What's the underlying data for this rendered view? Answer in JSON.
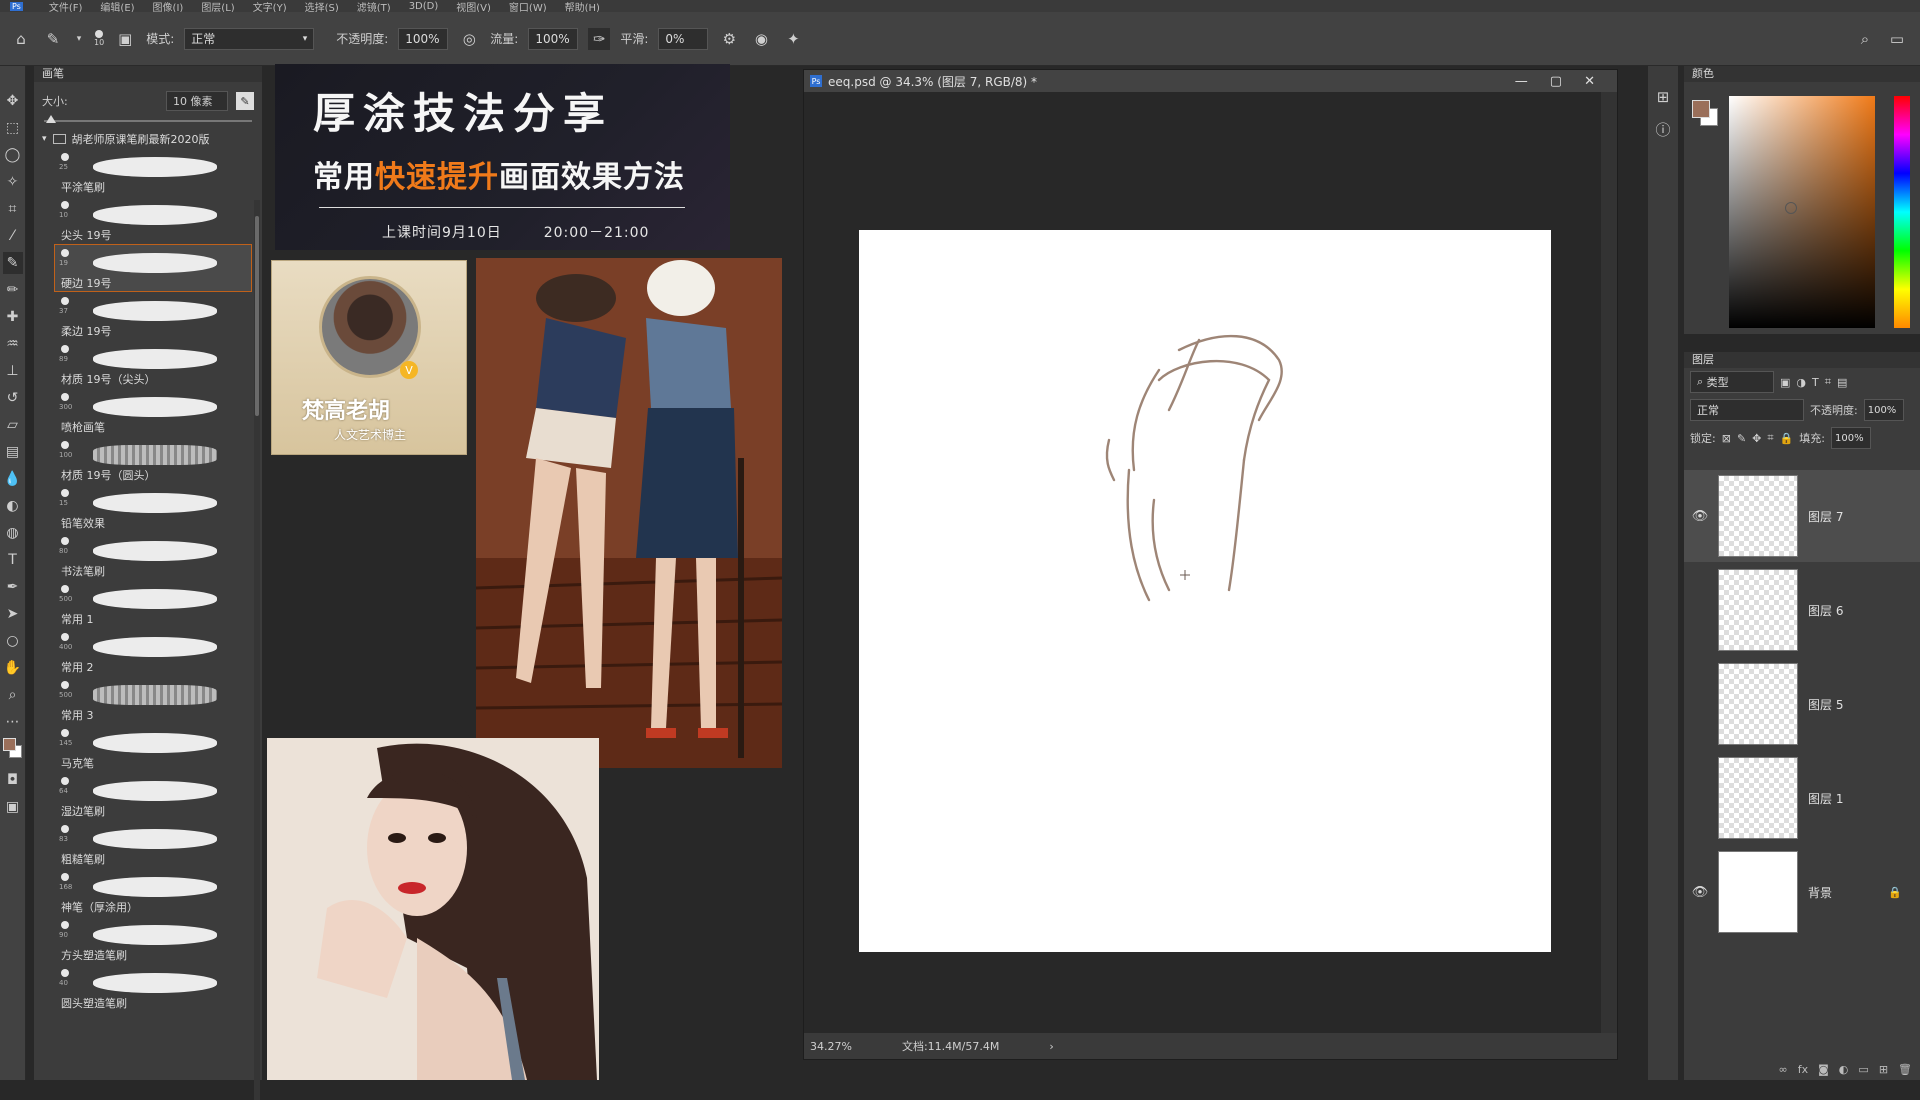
{
  "menu": {
    "items": [
      "文件(F)",
      "编辑(E)",
      "图像(I)",
      "图层(L)",
      "文字(Y)",
      "选择(S)",
      "滤镜(T)",
      "3D(D)",
      "视图(V)",
      "窗口(W)",
      "帮助(H)"
    ]
  },
  "options": {
    "brush_size_small": "10",
    "mode_label": "模式:",
    "mode_value": "正常",
    "opacity_label": "不透明度:",
    "opacity_value": "100%",
    "flow_label": "流量:",
    "flow_value": "100%",
    "smooth_label": "平滑:",
    "smooth_value": "0%"
  },
  "brush_panel": {
    "title": "画笔",
    "size_label": "大小:",
    "size_value": "10 像素",
    "folder": "胡老师原课笔刷最新2020版",
    "brushes": [
      {
        "num": "25",
        "label": "平涂笔刷"
      },
      {
        "num": "10",
        "label": "尖头 19号"
      },
      {
        "num": "19",
        "label": "硬边 19号"
      },
      {
        "num": "37",
        "label": "柔边 19号"
      },
      {
        "num": "89",
        "label": "材质 19号（尖头）"
      },
      {
        "num": "300",
        "label": "喷枪画笔"
      },
      {
        "num": "100",
        "label": "材质 19号（圆头）"
      },
      {
        "num": "15",
        "label": "铅笔效果"
      },
      {
        "num": "80",
        "label": "书法笔刷"
      },
      {
        "num": "500",
        "label": "常用 1"
      },
      {
        "num": "400",
        "label": "常用 2"
      },
      {
        "num": "500",
        "label": "常用 3"
      },
      {
        "num": "145",
        "label": "马克笔"
      },
      {
        "num": "64",
        "label": "湿边笔刷"
      },
      {
        "num": "83",
        "label": "粗糙笔刷"
      },
      {
        "num": "168",
        "label": "神笔（厚涂用）"
      },
      {
        "num": "90",
        "label": "方头塑造笔刷"
      },
      {
        "num": "40",
        "label": "圆头塑造笔刷"
      }
    ],
    "selected_index": 2
  },
  "banner": {
    "title": "厚涂技法分享",
    "subtitle_pre": "常用",
    "subtitle_highlight": "快速提升",
    "subtitle_post": "画面效果方法",
    "schedule_date": "上课时间9月10日",
    "schedule_time": "20:00－21:00"
  },
  "avatar_card": {
    "name": "梵高老胡",
    "subtitle": "人文艺术博主",
    "badge": "V"
  },
  "document": {
    "title": "eeq.psd @ 34.3% (图层 7, RGB/8) *",
    "zoom": "34.27%",
    "doc_info": "文档:11.4M/57.4M"
  },
  "color_panel": {
    "title": "颜色",
    "foreground": "#9a6f5a",
    "background": "#ffffff"
  },
  "layers_panel": {
    "title": "图层",
    "filter_label": "类型",
    "blend_mode": "正常",
    "opacity_label": "不透明度:",
    "opacity_value": "100%",
    "lock_label": "锁定:",
    "fill_label": "填充:",
    "fill_value": "100%",
    "layers": [
      {
        "name": "图层 7",
        "visible": true,
        "active": true
      },
      {
        "name": "图层 6",
        "visible": false,
        "active": false
      },
      {
        "name": "图层 5",
        "visible": false,
        "active": false
      },
      {
        "name": "图层 1",
        "visible": false,
        "active": false
      },
      {
        "name": "背景",
        "visible": true,
        "active": false,
        "locked": true
      }
    ]
  }
}
